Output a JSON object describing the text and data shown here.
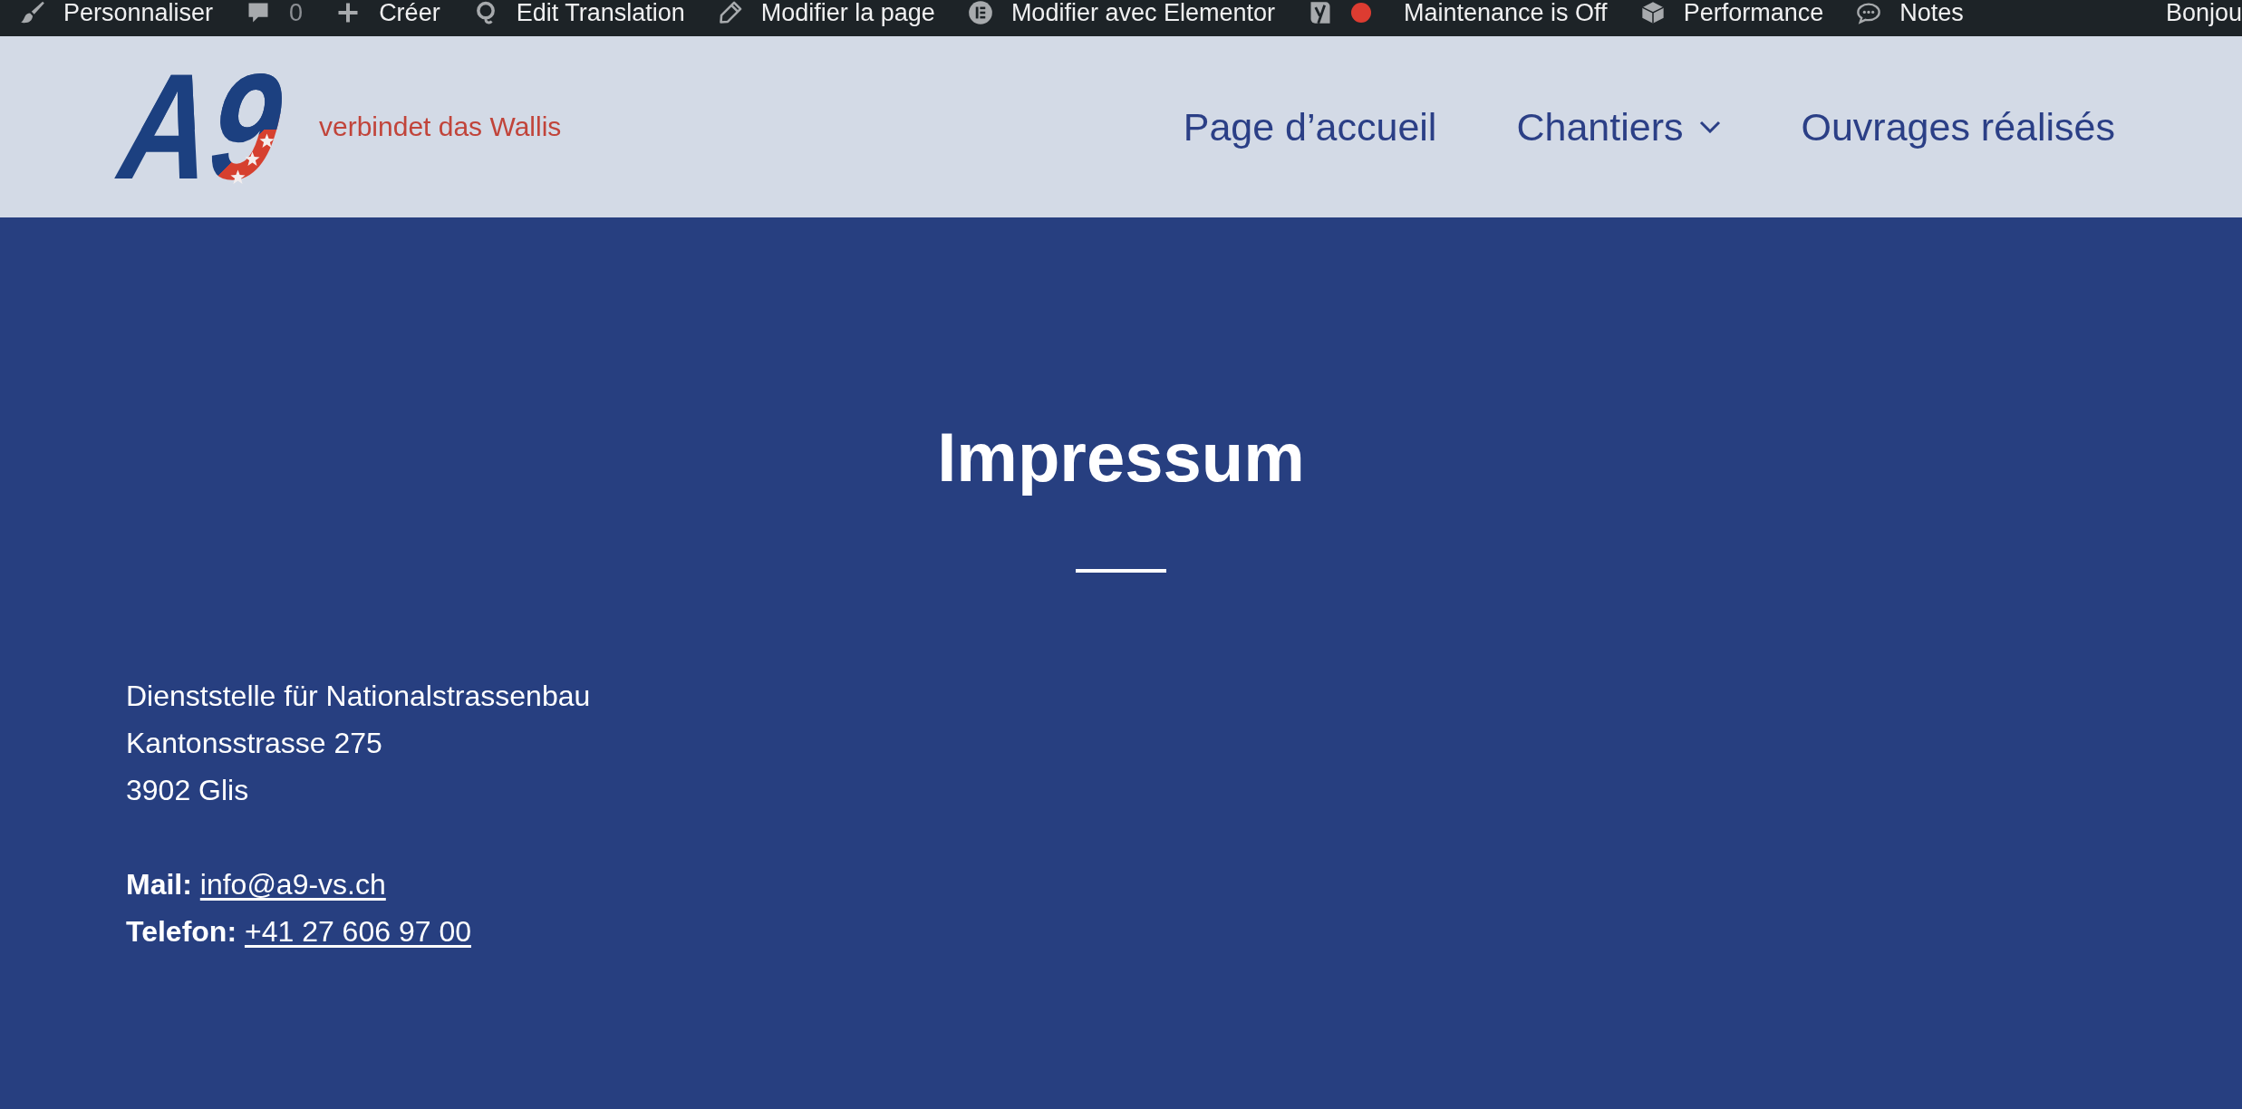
{
  "admin_bar": {
    "items": [
      {
        "kind": "brush",
        "label": "Personnaliser"
      },
      {
        "kind": "comments",
        "label": "0"
      },
      {
        "kind": "new",
        "label": "Créer"
      },
      {
        "kind": "translate",
        "label": "Edit Translation"
      },
      {
        "kind": "edit",
        "label": "Modifier la page"
      },
      {
        "kind": "builder",
        "label": "Modifier avec Elementor"
      },
      {
        "kind": "seo",
        "color": "#dd3c31"
      },
      {
        "kind": "plain",
        "label": "Maintenance is Off"
      },
      {
        "kind": "cache",
        "label": "Performance"
      },
      {
        "kind": "notes",
        "label": "Notes"
      }
    ],
    "account": {
      "label": "Bonjou"
    }
  },
  "header": {
    "logo": {
      "text": "A9"
    },
    "tagline": "verbindet das Wallis",
    "nav": [
      {
        "label": "Page d’accueil",
        "submenu": false
      },
      {
        "label": "Chantiers",
        "submenu": true
      },
      {
        "label": "Ouvrages réalisés",
        "submenu": false
      }
    ]
  },
  "page": {
    "title": "Impressum",
    "address": [
      "Dienststelle für Nationalstrassenbau",
      "Kantonsstrasse 275",
      "3902 Glis"
    ],
    "contacts": [
      {
        "label": "Mail:",
        "value": "info@a9-vs.ch"
      },
      {
        "label": "Telefon:",
        "value": "+41 27 606 97 00"
      }
    ]
  }
}
